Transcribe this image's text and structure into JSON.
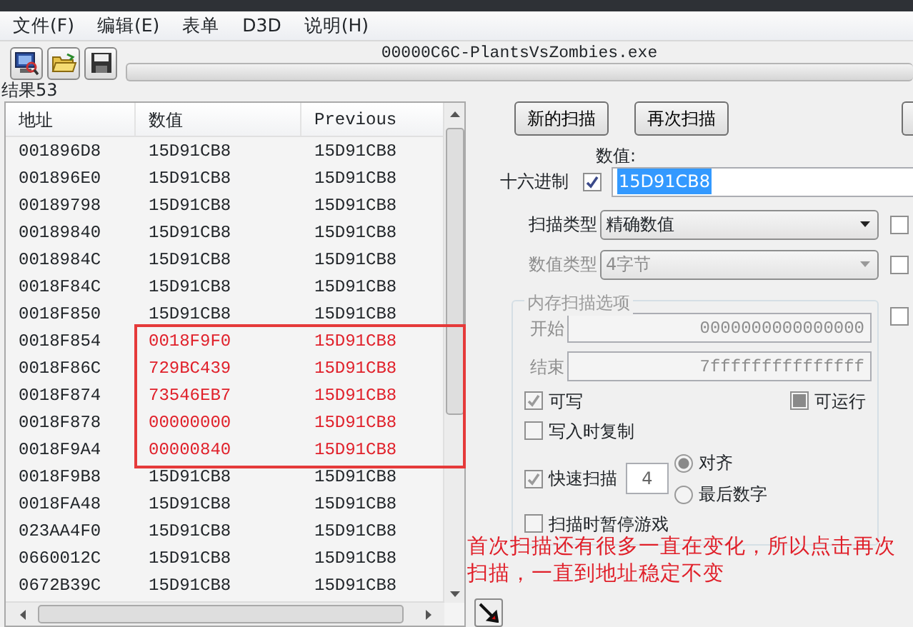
{
  "menu": [
    "文件(F)",
    "编辑(E)",
    "表单",
    "D3D",
    "说明(H)"
  ],
  "process_title": "00000C6C-PlantsVsZombies.exe",
  "scan_progress": {
    "level": 0
  },
  "results_label": "结果53",
  "table": {
    "columns": [
      "地址",
      "数值",
      "Previous"
    ],
    "rows": [
      {
        "address": "001896D8",
        "value": "15D91CB8",
        "previous": "15D91CB8",
        "changed": false
      },
      {
        "address": "001896E0",
        "value": "15D91CB8",
        "previous": "15D91CB8",
        "changed": false
      },
      {
        "address": "00189798",
        "value": "15D91CB8",
        "previous": "15D91CB8",
        "changed": false
      },
      {
        "address": "00189840",
        "value": "15D91CB8",
        "previous": "15D91CB8",
        "changed": false
      },
      {
        "address": "0018984C",
        "value": "15D91CB8",
        "previous": "15D91CB8",
        "changed": false
      },
      {
        "address": "0018F84C",
        "value": "15D91CB8",
        "previous": "15D91CB8",
        "changed": false
      },
      {
        "address": "0018F850",
        "value": "15D91CB8",
        "previous": "15D91CB8",
        "changed": false
      },
      {
        "address": "0018F854",
        "value": "0018F9F0",
        "previous": "15D91CB8",
        "changed": true
      },
      {
        "address": "0018F86C",
        "value": "729BC439",
        "previous": "15D91CB8",
        "changed": true
      },
      {
        "address": "0018F874",
        "value": "73546EB7",
        "previous": "15D91CB8",
        "changed": true
      },
      {
        "address": "0018F878",
        "value": "00000000",
        "previous": "15D91CB8",
        "changed": true
      },
      {
        "address": "0018F9A4",
        "value": "00000840",
        "previous": "15D91CB8",
        "changed": true
      },
      {
        "address": "0018F9B8",
        "value": "15D91CB8",
        "previous": "15D91CB8",
        "changed": false
      },
      {
        "address": "0018FA48",
        "value": "15D91CB8",
        "previous": "15D91CB8",
        "changed": false
      },
      {
        "address": "023AA4F0",
        "value": "15D91CB8",
        "previous": "15D91CB8",
        "changed": false
      },
      {
        "address": "0660012C",
        "value": "15D91CB8",
        "previous": "15D91CB8",
        "changed": false
      },
      {
        "address": "0672B39C",
        "value": "15D91CB8",
        "previous": "15D91CB8",
        "changed": false
      }
    ]
  },
  "scan": {
    "buttons": [
      "新的扫描",
      "再次扫描"
    ],
    "value_label": "数值:",
    "hex_label": "十六进制",
    "hex_checked": true,
    "value": "15D91CB8",
    "scan_type_label": "扫描类型",
    "scan_type": "精确数值",
    "value_type_label": "数值类型",
    "value_type": "4字节",
    "side_checks": [
      {
        "checked": false
      },
      {
        "checked": false
      },
      {
        "checked": false
      }
    ],
    "memory_options": {
      "title": "内存扫描选项",
      "start_label": "开始",
      "start": "0000000000000000",
      "stop_label": "结束",
      "stop": "7fffffffffffffff",
      "writable": {
        "label": "可写",
        "checked": true
      },
      "executable": {
        "label": "可运行",
        "mixed": true
      },
      "copy_on_write": {
        "label": "写入时复制",
        "checked": false
      },
      "fast_scan": {
        "label": "快速扫描",
        "checked": true,
        "digits": "4"
      },
      "alignment": [
        {
          "label": "对齐",
          "selected": true
        },
        {
          "label": "最后数字",
          "selected": false
        }
      ],
      "pause": {
        "label": "扫描时暂停游戏",
        "checked": false
      }
    }
  },
  "annotation": "首次扫描还有很多一直在变化，所以点击再次扫描，一直到地址稳定不变"
}
